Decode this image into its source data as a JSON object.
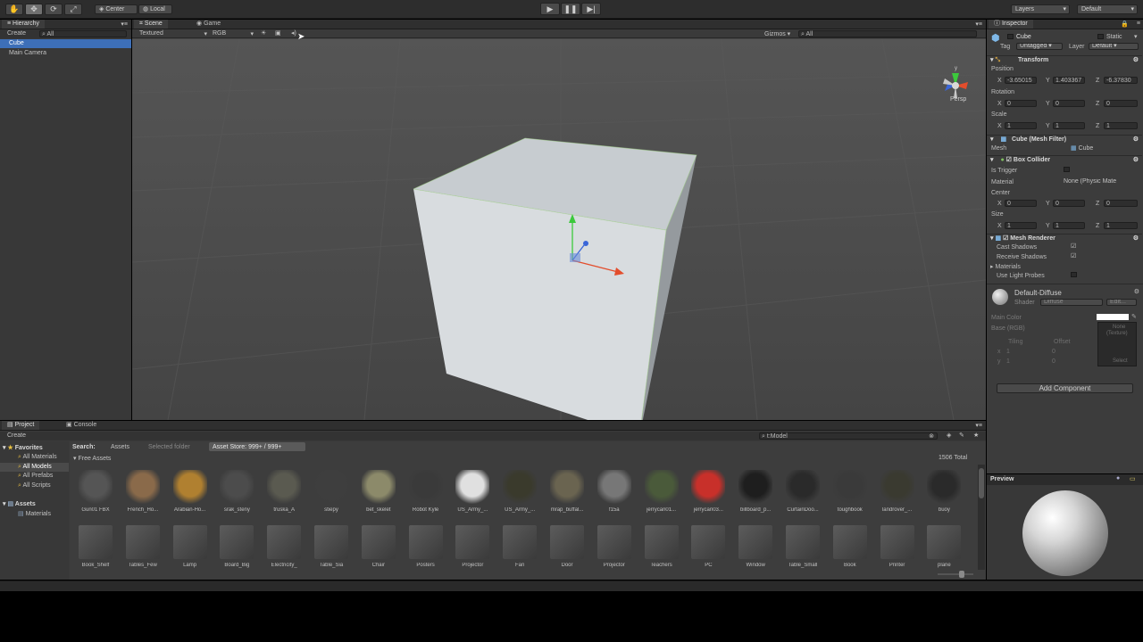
{
  "toolbar": {
    "tools": [
      "hand-icon",
      "move-icon",
      "rotate-icon",
      "scale-icon"
    ],
    "pivot": "Center",
    "space": "Local",
    "layers": "Layers",
    "layout": "Default"
  },
  "hierarchy": {
    "tab": "Hierarchy",
    "create": "Create",
    "search": "All",
    "items": [
      "Cube",
      "Main Camera"
    ]
  },
  "scene": {
    "tab_scene": "Scene",
    "tab_game": "Game",
    "render_mode": "Textured",
    "color_mode": "RGB",
    "gizmos": "Gizmos",
    "search": "All",
    "persp": "Persp"
  },
  "inspector": {
    "tab": "Inspector",
    "object_name": "Cube",
    "static": "Static",
    "tag_label": "Tag",
    "tag": "Untagged",
    "layer_label": "Layer",
    "layer": "Default",
    "transform": {
      "title": "Transform",
      "position_label": "Position",
      "position": {
        "x": "-3.65015",
        "y": "1.403367",
        "z": "-6.37830"
      },
      "rotation_label": "Rotation",
      "rotation": {
        "x": "0",
        "y": "0",
        "z": "0"
      },
      "scale_label": "Scale",
      "scale": {
        "x": "1",
        "y": "1",
        "z": "1"
      }
    },
    "mesh_filter": {
      "title": "Cube (Mesh Filter)",
      "mesh_label": "Mesh",
      "mesh": "Cube"
    },
    "box_collider": {
      "title": "Box Collider",
      "is_trigger": "Is Trigger",
      "material_label": "Material",
      "material": "None (Physic Mate",
      "center_label": "Center",
      "center": {
        "x": "0",
        "y": "0",
        "z": "0"
      },
      "size_label": "Size",
      "size": {
        "x": "1",
        "y": "1",
        "z": "1"
      }
    },
    "mesh_renderer": {
      "title": "Mesh Renderer",
      "cast_shadows": "Cast Shadows",
      "receive_shadows": "Receive Shadows",
      "materials": "Materials",
      "use_light_probes": "Use Light Probes"
    },
    "material": {
      "name": "Default-Diffuse",
      "shader_label": "Shader",
      "shader": "Diffuse",
      "edit": "Edit...",
      "main_color": "Main Color",
      "base": "Base (RGB)",
      "tiling": "Tiling",
      "offset": "Offset",
      "texture_none": "None",
      "texture_label": "(Texture)",
      "select": "Select",
      "tiling_x": "1",
      "tiling_y": "1",
      "offset_x": "0",
      "offset_y": "0"
    },
    "add_component": "Add Component",
    "preview": "Preview"
  },
  "project": {
    "tab_project": "Project",
    "tab_console": "Console",
    "create": "Create",
    "search_text": "t:Model",
    "search_label": "Search:",
    "scope_assets": "Assets",
    "scope_selected": "Selected folder",
    "scope_store": "Asset Store: 999+ / 999+",
    "free_assets": "Free Assets",
    "total": "1506 Total",
    "favorites": {
      "title": "Favorites",
      "items": [
        "All Materials",
        "All Models",
        "All Prefabs",
        "All Scripts"
      ]
    },
    "assets_folder": {
      "title": "Assets",
      "items": [
        "Materials"
      ]
    },
    "row1": [
      "Gun01 FBX",
      "French_Ho...",
      "Arabian-Ho...",
      "srak_steny",
      "truska_A",
      "stiepy",
      "bet_skelet",
      "Robot Kyle",
      "US_Army_...",
      "US_Army_...",
      "mrap_buffal...",
      "f15a",
      "jerrycan01...",
      "jerrycan03...",
      "billboard_p...",
      "CurtainDoo...",
      "toughbook",
      "landrover_...",
      "buoy"
    ],
    "row2": [
      "Book_Shelf",
      "Tables_Few",
      "Lamp",
      "Board_Big",
      "Electricity_",
      "Table_Sia",
      "Chair",
      "Posters",
      "Projector",
      "Fan",
      "Door",
      "Projector",
      "Teachers",
      "PC",
      "Window",
      "Table_Small",
      "Book",
      "Printer",
      "plane"
    ]
  },
  "colors": {
    "accent": "#3d6fb8",
    "panel": "#383838",
    "scene_bg": "#484848"
  }
}
